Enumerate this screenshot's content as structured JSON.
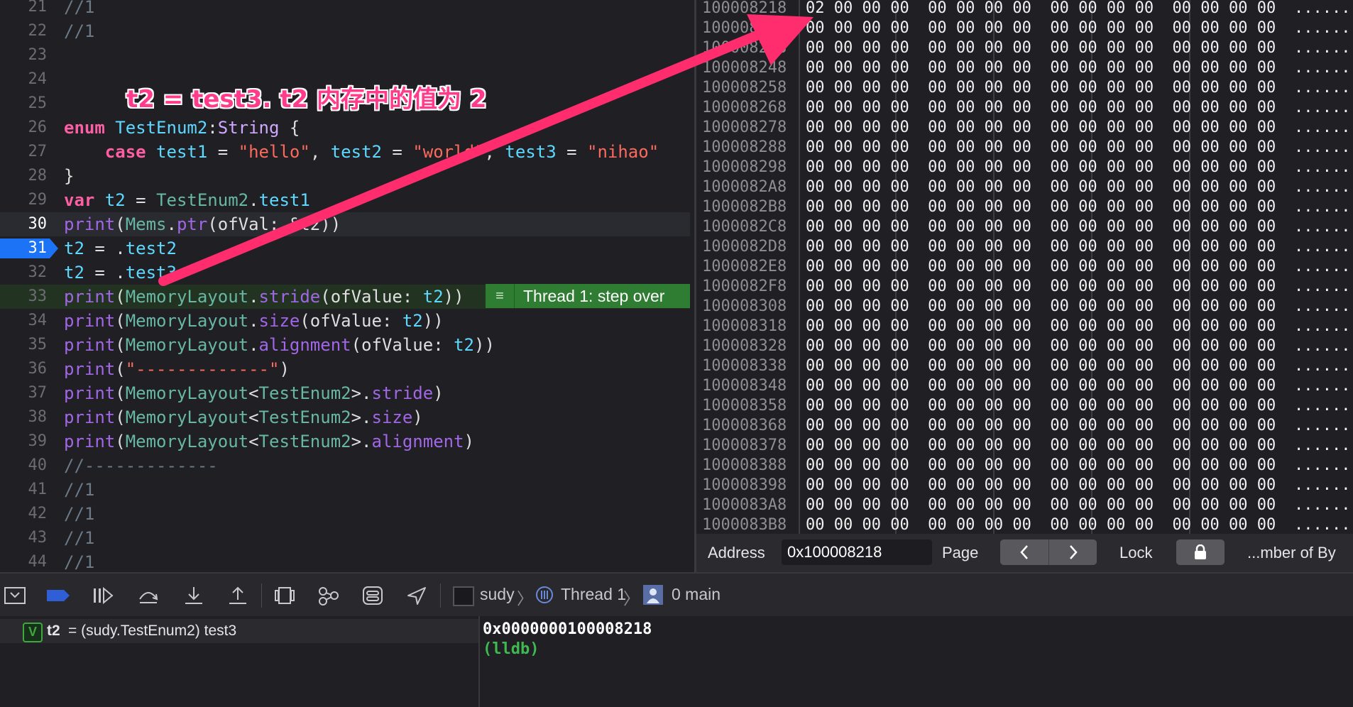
{
  "editor": {
    "lines": [
      {
        "num": "21",
        "tokens": [
          {
            "t": "//1",
            "c": "cm"
          }
        ]
      },
      {
        "num": "22",
        "tokens": [
          {
            "t": "//1",
            "c": "cm"
          }
        ]
      },
      {
        "num": "23",
        "tokens": []
      },
      {
        "num": "24",
        "tokens": []
      },
      {
        "num": "25",
        "tokens": []
      },
      {
        "num": "26",
        "tokens": [
          {
            "t": "enum ",
            "c": "k"
          },
          {
            "t": "TestEnum2",
            "c": "t"
          },
          {
            "t": ":",
            "c": "p"
          },
          {
            "t": "String",
            "c": "ty"
          },
          {
            "t": " {",
            "c": "p"
          }
        ]
      },
      {
        "num": "27",
        "tokens": [
          {
            "t": "    case ",
            "c": "k"
          },
          {
            "t": "test1",
            "c": "t"
          },
          {
            "t": " = ",
            "c": "p"
          },
          {
            "t": "\"hello\"",
            "c": "s"
          },
          {
            "t": ", ",
            "c": "p"
          },
          {
            "t": "test2",
            "c": "t"
          },
          {
            "t": " = ",
            "c": "p"
          },
          {
            "t": "\"world\"",
            "c": "s"
          },
          {
            "t": ", ",
            "c": "p"
          },
          {
            "t": "test3",
            "c": "t"
          },
          {
            "t": " = ",
            "c": "p"
          },
          {
            "t": "\"nihao\"",
            "c": "s"
          }
        ]
      },
      {
        "num": "28",
        "tokens": [
          {
            "t": "}",
            "c": "p"
          }
        ]
      },
      {
        "num": "29",
        "tokens": [
          {
            "t": "var ",
            "c": "k"
          },
          {
            "t": "t2",
            "c": "t"
          },
          {
            "t": " = ",
            "c": "p"
          },
          {
            "t": "TestEnum2",
            "c": "f"
          },
          {
            "t": ".",
            "c": "p"
          },
          {
            "t": "test1",
            "c": "t"
          }
        ]
      },
      {
        "num": "30",
        "tokens": [
          {
            "t": "print",
            "c": "fn"
          },
          {
            "t": "(",
            "c": "p"
          },
          {
            "t": "Mems",
            "c": "f"
          },
          {
            "t": ".",
            "c": "p"
          },
          {
            "t": "ptr",
            "c": "fn"
          },
          {
            "t": "(ofVal: &t2))",
            "c": "p"
          }
        ]
      },
      {
        "num": "31",
        "tokens": [
          {
            "t": "t2",
            "c": "t"
          },
          {
            "t": " = .",
            "c": "p"
          },
          {
            "t": "test2",
            "c": "t"
          }
        ]
      },
      {
        "num": "32",
        "tokens": [
          {
            "t": "t2",
            "c": "t"
          },
          {
            "t": " = .",
            "c": "p"
          },
          {
            "t": "test3",
            "c": "t"
          }
        ]
      },
      {
        "num": "33",
        "tokens": [
          {
            "t": "print",
            "c": "fn"
          },
          {
            "t": "(",
            "c": "p"
          },
          {
            "t": "MemoryLayout",
            "c": "f"
          },
          {
            "t": ".",
            "c": "p"
          },
          {
            "t": "stride",
            "c": "fn"
          },
          {
            "t": "(ofValue: ",
            "c": "p"
          },
          {
            "t": "t2",
            "c": "t"
          },
          {
            "t": "))",
            "c": "p"
          }
        ]
      },
      {
        "num": "34",
        "tokens": [
          {
            "t": "print",
            "c": "fn"
          },
          {
            "t": "(",
            "c": "p"
          },
          {
            "t": "MemoryLayout",
            "c": "f"
          },
          {
            "t": ".",
            "c": "p"
          },
          {
            "t": "size",
            "c": "fn"
          },
          {
            "t": "(ofValue: ",
            "c": "p"
          },
          {
            "t": "t2",
            "c": "t"
          },
          {
            "t": "))",
            "c": "p"
          }
        ]
      },
      {
        "num": "35",
        "tokens": [
          {
            "t": "print",
            "c": "fn"
          },
          {
            "t": "(",
            "c": "p"
          },
          {
            "t": "MemoryLayout",
            "c": "f"
          },
          {
            "t": ".",
            "c": "p"
          },
          {
            "t": "alignment",
            "c": "fn"
          },
          {
            "t": "(ofValue: ",
            "c": "p"
          },
          {
            "t": "t2",
            "c": "t"
          },
          {
            "t": "))",
            "c": "p"
          }
        ]
      },
      {
        "num": "36",
        "tokens": [
          {
            "t": "print",
            "c": "fn"
          },
          {
            "t": "(",
            "c": "p"
          },
          {
            "t": "\"-------------\"",
            "c": "s"
          },
          {
            "t": ")",
            "c": "p"
          }
        ]
      },
      {
        "num": "37",
        "tokens": [
          {
            "t": "print",
            "c": "fn"
          },
          {
            "t": "(",
            "c": "p"
          },
          {
            "t": "MemoryLayout",
            "c": "f"
          },
          {
            "t": "<",
            "c": "p"
          },
          {
            "t": "TestEnum2",
            "c": "f"
          },
          {
            "t": ">.",
            "c": "p"
          },
          {
            "t": "stride",
            "c": "fn"
          },
          {
            "t": ")",
            "c": "p"
          }
        ]
      },
      {
        "num": "38",
        "tokens": [
          {
            "t": "print",
            "c": "fn"
          },
          {
            "t": "(",
            "c": "p"
          },
          {
            "t": "MemoryLayout",
            "c": "f"
          },
          {
            "t": "<",
            "c": "p"
          },
          {
            "t": "TestEnum2",
            "c": "f"
          },
          {
            "t": ">.",
            "c": "p"
          },
          {
            "t": "size",
            "c": "fn"
          },
          {
            "t": ")",
            "c": "p"
          }
        ]
      },
      {
        "num": "39",
        "tokens": [
          {
            "t": "print",
            "c": "fn"
          },
          {
            "t": "(",
            "c": "p"
          },
          {
            "t": "MemoryLayout",
            "c": "f"
          },
          {
            "t": "<",
            "c": "p"
          },
          {
            "t": "TestEnum2",
            "c": "f"
          },
          {
            "t": ">.",
            "c": "p"
          },
          {
            "t": "alignment",
            "c": "fn"
          },
          {
            "t": ")",
            "c": "p"
          }
        ]
      },
      {
        "num": "40",
        "tokens": [
          {
            "t": "//-------------",
            "c": "cm"
          }
        ]
      },
      {
        "num": "41",
        "tokens": [
          {
            "t": "//1",
            "c": "cm"
          }
        ]
      },
      {
        "num": "42",
        "tokens": [
          {
            "t": "//1",
            "c": "cm"
          }
        ]
      },
      {
        "num": "43",
        "tokens": [
          {
            "t": "//1",
            "c": "cm"
          }
        ]
      },
      {
        "num": "44",
        "tokens": [
          {
            "t": "//1",
            "c": "cm"
          }
        ]
      }
    ],
    "current_line": "31",
    "highlight_line": "30",
    "step_line": "33",
    "thread_badge": "Thread 1: step over",
    "annotation": "t2 = test3. t2 内存中的值为 2",
    "annotation_color": "#ff3b8b"
  },
  "memory": {
    "rows": [
      {
        "addr": "100008218",
        "bytes": "02 00 00 00  00 00 00 00  00 00 00 00  00 00 00 00"
      },
      {
        "addr": "100008228",
        "bytes": "00 00 00 00  00 00 00 00  00 00 00 00  00 00 00 00"
      },
      {
        "addr": "100008238",
        "bytes": "00 00 00 00  00 00 00 00  00 00 00 00  00 00 00 00"
      },
      {
        "addr": "100008248",
        "bytes": "00 00 00 00  00 00 00 00  00 00 00 00  00 00 00 00"
      },
      {
        "addr": "100008258",
        "bytes": "00 00 00 00  00 00 00 00  00 00 00 00  00 00 00 00"
      },
      {
        "addr": "100008268",
        "bytes": "00 00 00 00  00 00 00 00  00 00 00 00  00 00 00 00"
      },
      {
        "addr": "100008278",
        "bytes": "00 00 00 00  00 00 00 00  00 00 00 00  00 00 00 00"
      },
      {
        "addr": "100008288",
        "bytes": "00 00 00 00  00 00 00 00  00 00 00 00  00 00 00 00"
      },
      {
        "addr": "100008298",
        "bytes": "00 00 00 00  00 00 00 00  00 00 00 00  00 00 00 00"
      },
      {
        "addr": "1000082A8",
        "bytes": "00 00 00 00  00 00 00 00  00 00 00 00  00 00 00 00"
      },
      {
        "addr": "1000082B8",
        "bytes": "00 00 00 00  00 00 00 00  00 00 00 00  00 00 00 00"
      },
      {
        "addr": "1000082C8",
        "bytes": "00 00 00 00  00 00 00 00  00 00 00 00  00 00 00 00"
      },
      {
        "addr": "1000082D8",
        "bytes": "00 00 00 00  00 00 00 00  00 00 00 00  00 00 00 00"
      },
      {
        "addr": "1000082E8",
        "bytes": "00 00 00 00  00 00 00 00  00 00 00 00  00 00 00 00"
      },
      {
        "addr": "1000082F8",
        "bytes": "00 00 00 00  00 00 00 00  00 00 00 00  00 00 00 00"
      },
      {
        "addr": "100008308",
        "bytes": "00 00 00 00  00 00 00 00  00 00 00 00  00 00 00 00"
      },
      {
        "addr": "100008318",
        "bytes": "00 00 00 00  00 00 00 00  00 00 00 00  00 00 00 00"
      },
      {
        "addr": "100008328",
        "bytes": "00 00 00 00  00 00 00 00  00 00 00 00  00 00 00 00"
      },
      {
        "addr": "100008338",
        "bytes": "00 00 00 00  00 00 00 00  00 00 00 00  00 00 00 00"
      },
      {
        "addr": "100008348",
        "bytes": "00 00 00 00  00 00 00 00  00 00 00 00  00 00 00 00"
      },
      {
        "addr": "100008358",
        "bytes": "00 00 00 00  00 00 00 00  00 00 00 00  00 00 00 00"
      },
      {
        "addr": "100008368",
        "bytes": "00 00 00 00  00 00 00 00  00 00 00 00  00 00 00 00"
      },
      {
        "addr": "100008378",
        "bytes": "00 00 00 00  00 00 00 00  00 00 00 00  00 00 00 00"
      },
      {
        "addr": "100008388",
        "bytes": "00 00 00 00  00 00 00 00  00 00 00 00  00 00 00 00"
      },
      {
        "addr": "100008398",
        "bytes": "00 00 00 00  00 00 00 00  00 00 00 00  00 00 00 00"
      },
      {
        "addr": "1000083A8",
        "bytes": "00 00 00 00  00 00 00 00  00 00 00 00  00 00 00 00"
      },
      {
        "addr": "1000083B8",
        "bytes": "00 00 00 00  00 00 00 00  00 00 00 00  00 00 00 00"
      }
    ],
    "ascii": "......",
    "footer": {
      "address_label": "Address",
      "address_value": "0x100008218",
      "page_label": "Page",
      "lock_label": "Lock",
      "bytes_label": "...mber of By"
    }
  },
  "debug_bar": {
    "icons": [
      "hide-debug-area-icon",
      "breakpoints-toggle-icon",
      "continue-icon",
      "step-over-icon",
      "step-into-icon",
      "step-out-icon",
      "view-debugger-icon",
      "memory-graph-icon",
      "environment-overrides-icon",
      "simulate-location-icon"
    ],
    "breadcrumb": {
      "project": "sudy",
      "thread": "Thread 1",
      "frame": "0 main"
    }
  },
  "variables": {
    "badge": "V",
    "name": "t2",
    "value": "= (sudy.TestEnum2) test3"
  },
  "console": {
    "lines": [
      "0x0000000100008218",
      "(lldb)"
    ]
  }
}
